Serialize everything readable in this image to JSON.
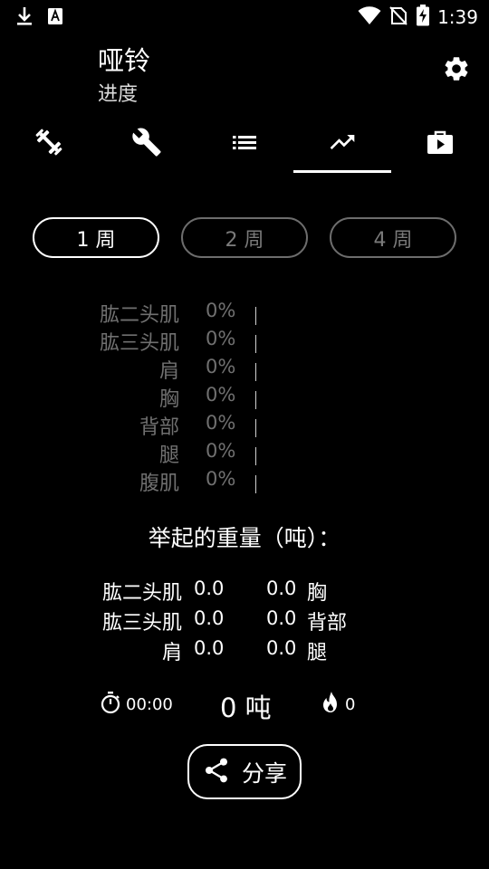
{
  "status_bar": {
    "time": "1:39",
    "icons": [
      "download-icon",
      "font-a-icon",
      "wifi-icon",
      "no-sim-icon",
      "battery-charging-icon"
    ]
  },
  "header": {
    "title": "哑铃",
    "subtitle": "进度",
    "settings_icon": "gear-icon"
  },
  "tabs": [
    {
      "icon": "dumbbell-icon",
      "active": false
    },
    {
      "icon": "wrench-icon",
      "active": false
    },
    {
      "icon": "list-icon",
      "active": false
    },
    {
      "icon": "trending-up-icon",
      "active": true
    },
    {
      "icon": "play-briefcase-icon",
      "active": false
    }
  ],
  "periods": [
    {
      "label": "1 周",
      "active": true
    },
    {
      "label": "2 周",
      "active": false
    },
    {
      "label": "4 周",
      "active": false
    }
  ],
  "muscles": [
    {
      "name": "肱二头肌",
      "pct": "0%"
    },
    {
      "name": "肱三头肌",
      "pct": "0%"
    },
    {
      "name": "肩",
      "pct": "0%"
    },
    {
      "name": "胸",
      "pct": "0%"
    },
    {
      "name": "背部",
      "pct": "0%"
    },
    {
      "name": "腿",
      "pct": "0%"
    },
    {
      "name": "腹肌",
      "pct": "0%"
    }
  ],
  "weight": {
    "title": "举起的重量（吨）：",
    "rows": [
      {
        "left_name": "肱二头肌",
        "left_value": "0.0",
        "right_value": "0.0",
        "right_name": "胸"
      },
      {
        "left_name": "肱三头肌",
        "left_value": "0.0",
        "right_value": "0.0",
        "right_name": "背部"
      },
      {
        "left_name": "肩",
        "left_value": "0.0",
        "right_value": "0.0",
        "right_name": "腿"
      }
    ]
  },
  "stats": {
    "duration": "00:00",
    "total": "0 吨",
    "streak": "0"
  },
  "share": {
    "label": "分享"
  }
}
